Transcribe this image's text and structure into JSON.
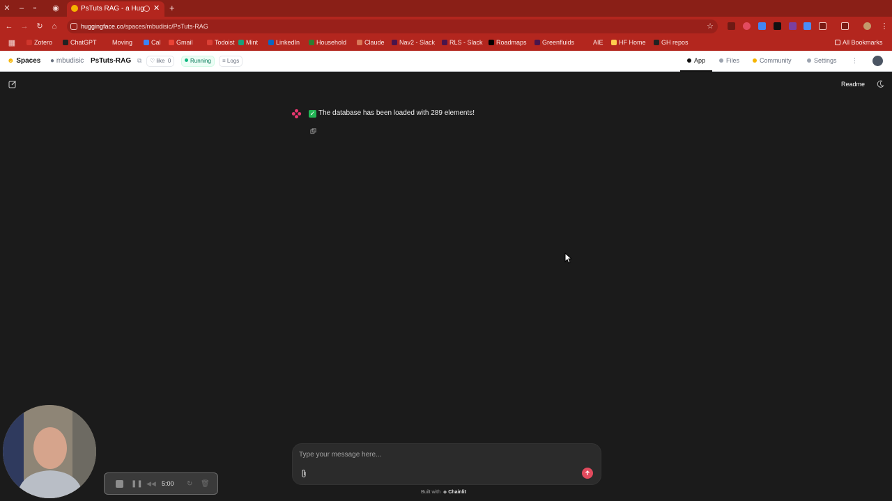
{
  "browser": {
    "tab_title": "PsTuts RAG - a Huggin",
    "url_host": "huggingface.co",
    "url_path": "/spaces/mbudisic/PsTuts-RAG",
    "bookmarks": [
      {
        "label": "Zotero",
        "color": "#d0362c"
      },
      {
        "label": "ChatGPT",
        "color": "#222222"
      },
      {
        "label": "Moving",
        "color": "#b3261e"
      },
      {
        "label": "Cal",
        "color": "#3b82f6"
      },
      {
        "label": "Gmail",
        "color": "#ea4335"
      },
      {
        "label": "Todoist",
        "color": "#db4035"
      },
      {
        "label": "Mint",
        "color": "#1aa07a"
      },
      {
        "label": "LinkedIn",
        "color": "#0a66c2"
      },
      {
        "label": "Household",
        "color": "#2e7d32"
      },
      {
        "label": "Claude",
        "color": "#d97757"
      },
      {
        "label": "Nav2 - Slack",
        "color": "#4a154b"
      },
      {
        "label": "RLS - Slack",
        "color": "#4a154b"
      },
      {
        "label": "Roadmaps",
        "color": "#000000"
      },
      {
        "label": "Greenfluids",
        "color": "#4a154b"
      },
      {
        "label": "AIE",
        "color": "#b3261e"
      },
      {
        "label": "HF Home",
        "color": "#ffcc4d"
      },
      {
        "label": "GH repos",
        "color": "#222222"
      }
    ],
    "all_bookmarks": "All Bookmarks"
  },
  "hf": {
    "spaces": "Spaces",
    "owner": "mbudisic",
    "repo": "PsTuts-RAG",
    "like": "like",
    "like_count": "0",
    "status": "Running",
    "logs": "Logs",
    "tabs": [
      "App",
      "Files",
      "Community",
      "Settings"
    ]
  },
  "chat": {
    "readme": "Readme",
    "message_check": "✓",
    "message": "The database has been loaded with 289 elements!",
    "input_placeholder": "Type your message here...",
    "built_with": "Built with",
    "built_brand": "Chainlit"
  },
  "recorder": {
    "time": "5:00"
  }
}
